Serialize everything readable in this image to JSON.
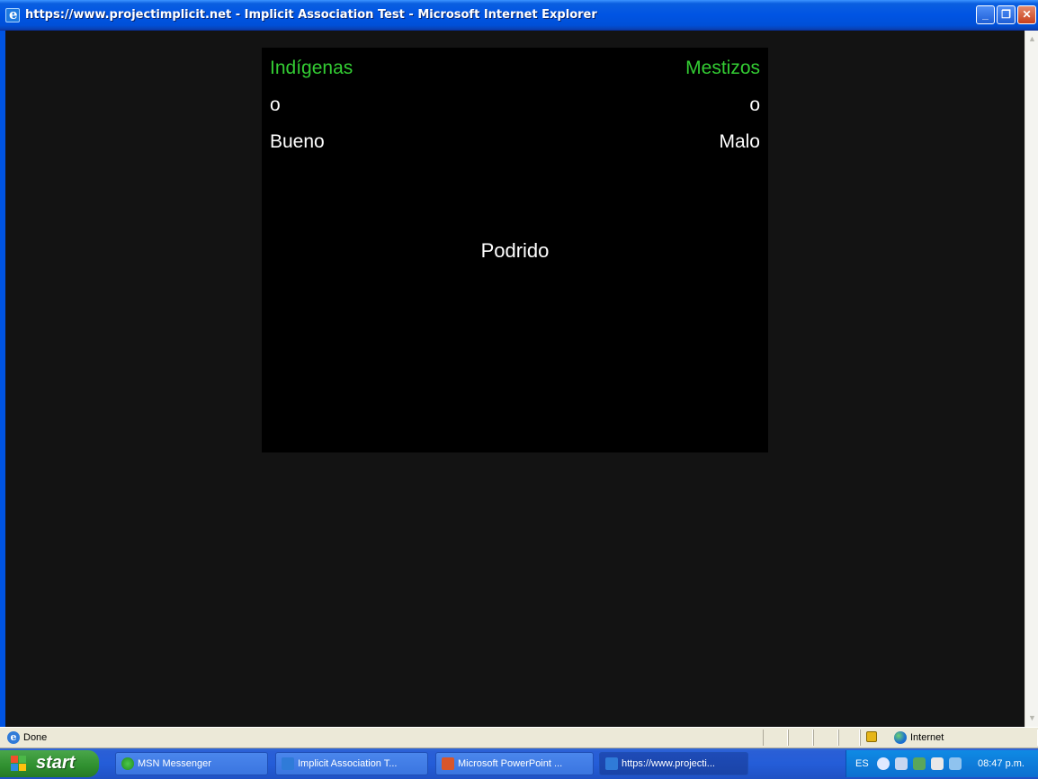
{
  "window": {
    "title": "https://www.projectimplicit.net - Implicit Association Test - Microsoft Internet Explorer",
    "minimize_glyph": "_",
    "maximize_glyph": "❐",
    "close_glyph": "✕"
  },
  "iat": {
    "left_category": "Indígenas",
    "right_category": "Mestizos",
    "left_connector": "o",
    "right_connector": "o",
    "left_attribute": "Bueno",
    "right_attribute": "Malo",
    "stimulus": "Podrido",
    "category_color": "#33cc33",
    "attribute_color": "#ffffff"
  },
  "statusbar": {
    "status": "Done",
    "zone": "Internet"
  },
  "taskbar": {
    "start_label": "start",
    "buttons": [
      {
        "label": "MSN Messenger",
        "icon": "msn-icon"
      },
      {
        "label": "Implicit Association T...",
        "icon": "ie-icon"
      },
      {
        "label": "Microsoft PowerPoint ...",
        "icon": "powerpoint-icon"
      },
      {
        "label": "https://www.projecti...",
        "icon": "ie-icon"
      }
    ],
    "tray": {
      "language": "ES",
      "clock": "08:47 p.m."
    }
  }
}
